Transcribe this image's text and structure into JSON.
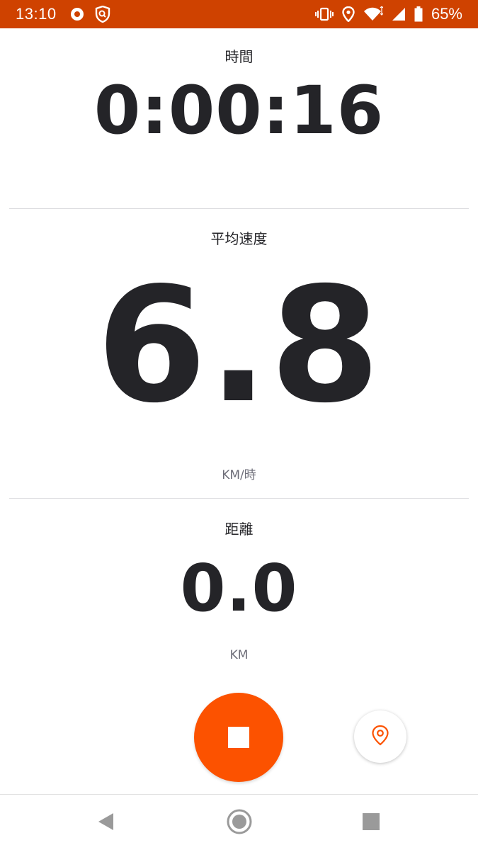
{
  "status_bar": {
    "time": "13:10",
    "battery": "65%",
    "icons": [
      "record-icon",
      "vpn-shield-icon",
      "vibrate-icon",
      "location-icon",
      "wifi-icon",
      "signal-icon",
      "battery-icon"
    ],
    "background_color": "#cf4200"
  },
  "metrics": {
    "time": {
      "label": "時間",
      "value": "0:00:16"
    },
    "avg_speed": {
      "label": "平均速度",
      "value": "6.8",
      "unit": "KM/時"
    },
    "distance": {
      "label": "距離",
      "value": "0.0",
      "unit": "KM"
    }
  },
  "controls": {
    "stop_button_icon": "stop-icon",
    "stop_button_color": "#fc5200",
    "location_button_icon": "map-pin-icon",
    "location_button_color": "#fc5200"
  },
  "nav_bar": {
    "buttons": [
      "back-icon",
      "home-icon",
      "recents-icon"
    ]
  }
}
